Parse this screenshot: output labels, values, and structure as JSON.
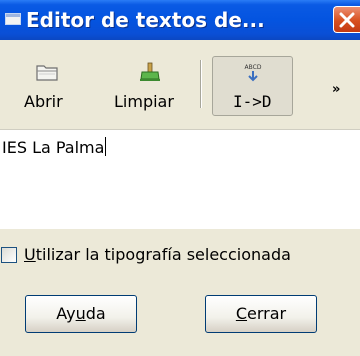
{
  "window": {
    "title": "Editor de textos de...",
    "close_glyph": "✕",
    "title_icon": "window-icon"
  },
  "toolbar": {
    "buttons": [
      {
        "label": "Abrir",
        "icon": "open-folder-icon"
      },
      {
        "label": "Limpiar",
        "icon": "broom-icon"
      },
      {
        "label": "I->D",
        "icon": "text-direction-icon",
        "icon_caption": "ABCD",
        "pressed": true
      }
    ],
    "overflow": "»"
  },
  "editor": {
    "value": "IES La Palma"
  },
  "checkbox": {
    "label_mnemonic": "U",
    "label_rest": "tilizar la tipografía seleccionada",
    "checked": false
  },
  "buttons": {
    "help_before": "Ay",
    "help_mnemonic": "u",
    "help_after": "da",
    "close_mnemonic": "C",
    "close_rest": "errar"
  },
  "colors": {
    "titlebar": "#0454e0",
    "close_button": "#d8501f",
    "window_bg": "#ece9d8",
    "button_border": "#003c74"
  }
}
